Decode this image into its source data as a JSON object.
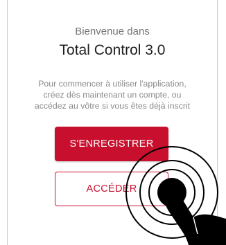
{
  "welcome": {
    "subtitle": "Bienvenue dans",
    "app_title": "Total Control 3.0",
    "description_lines": [
      "Pour commencer à utiliser l'application,",
      "créez dès maintenant un compte, ou",
      "accédez au vôtre si vous êtes déjà inscrit"
    ]
  },
  "buttons": {
    "register_label": "S'ENREGISTRER",
    "login_label": "ACCÉDER"
  },
  "colors": {
    "accent": "#c8102e",
    "text_dark": "#1f1f1f",
    "text_muted": "#8a8a8a",
    "gesture": "#000000"
  },
  "gesture": {
    "icon": "tap-gesture-icon",
    "target": "login-button"
  }
}
